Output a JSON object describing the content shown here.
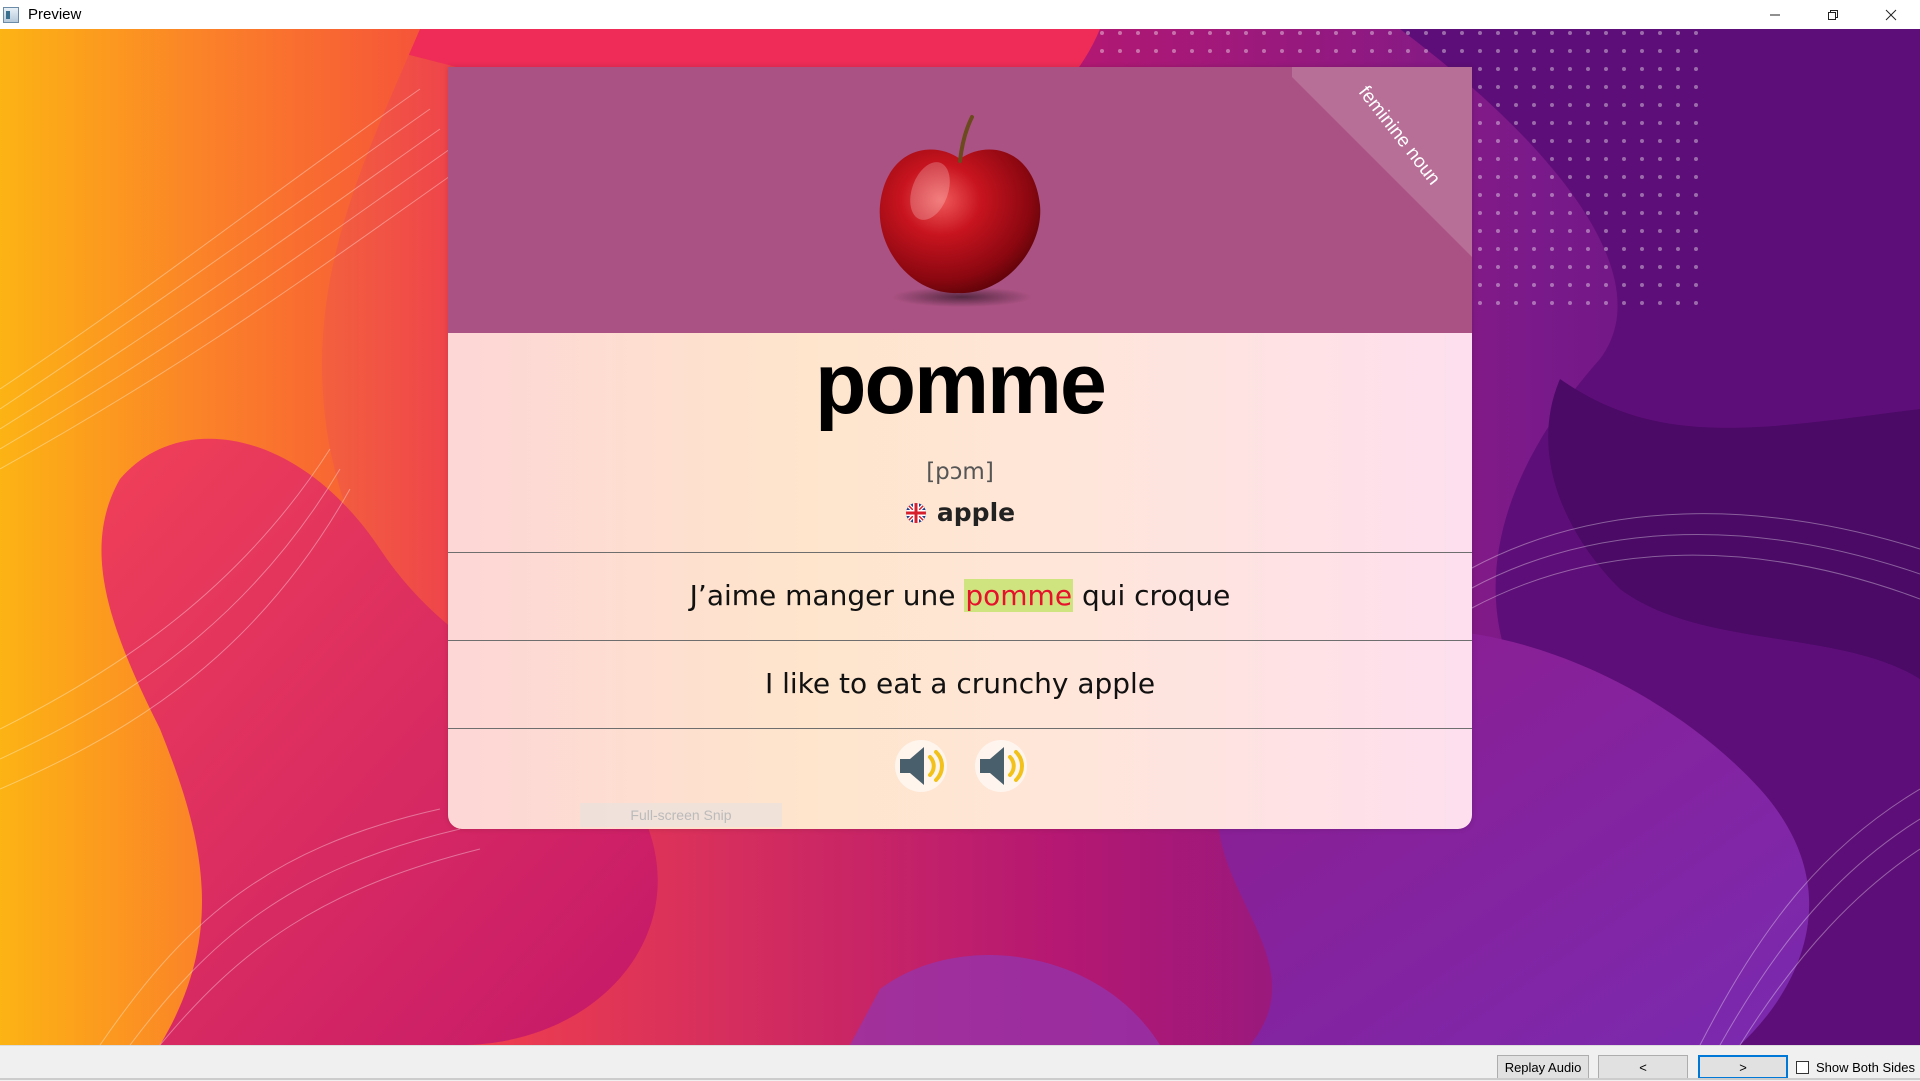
{
  "window": {
    "title": "Preview",
    "icon": "app-preview-icon"
  },
  "card": {
    "gender": "feminine noun",
    "word": "pomme",
    "ipa": "[pɔm]",
    "flag_icon": "uk-flag-icon",
    "translation": "apple",
    "sentence_fr": {
      "before": "J’aime manger une ",
      "highlight": "pomme",
      "after": " qui croque"
    },
    "sentence_en": "I like to eat a crunchy apple",
    "accent_colors": {
      "top_panel": "#aa5283",
      "highlight_text": "#e6112b",
      "highlight_bg": "#cfe47e"
    }
  },
  "overlay": {
    "snip_label": "Full-screen Snip"
  },
  "statusbar": {
    "replay_label": "Replay Audio",
    "prev_label": "<",
    "next_label": ">",
    "show_both_label": "Show Both Sides"
  }
}
